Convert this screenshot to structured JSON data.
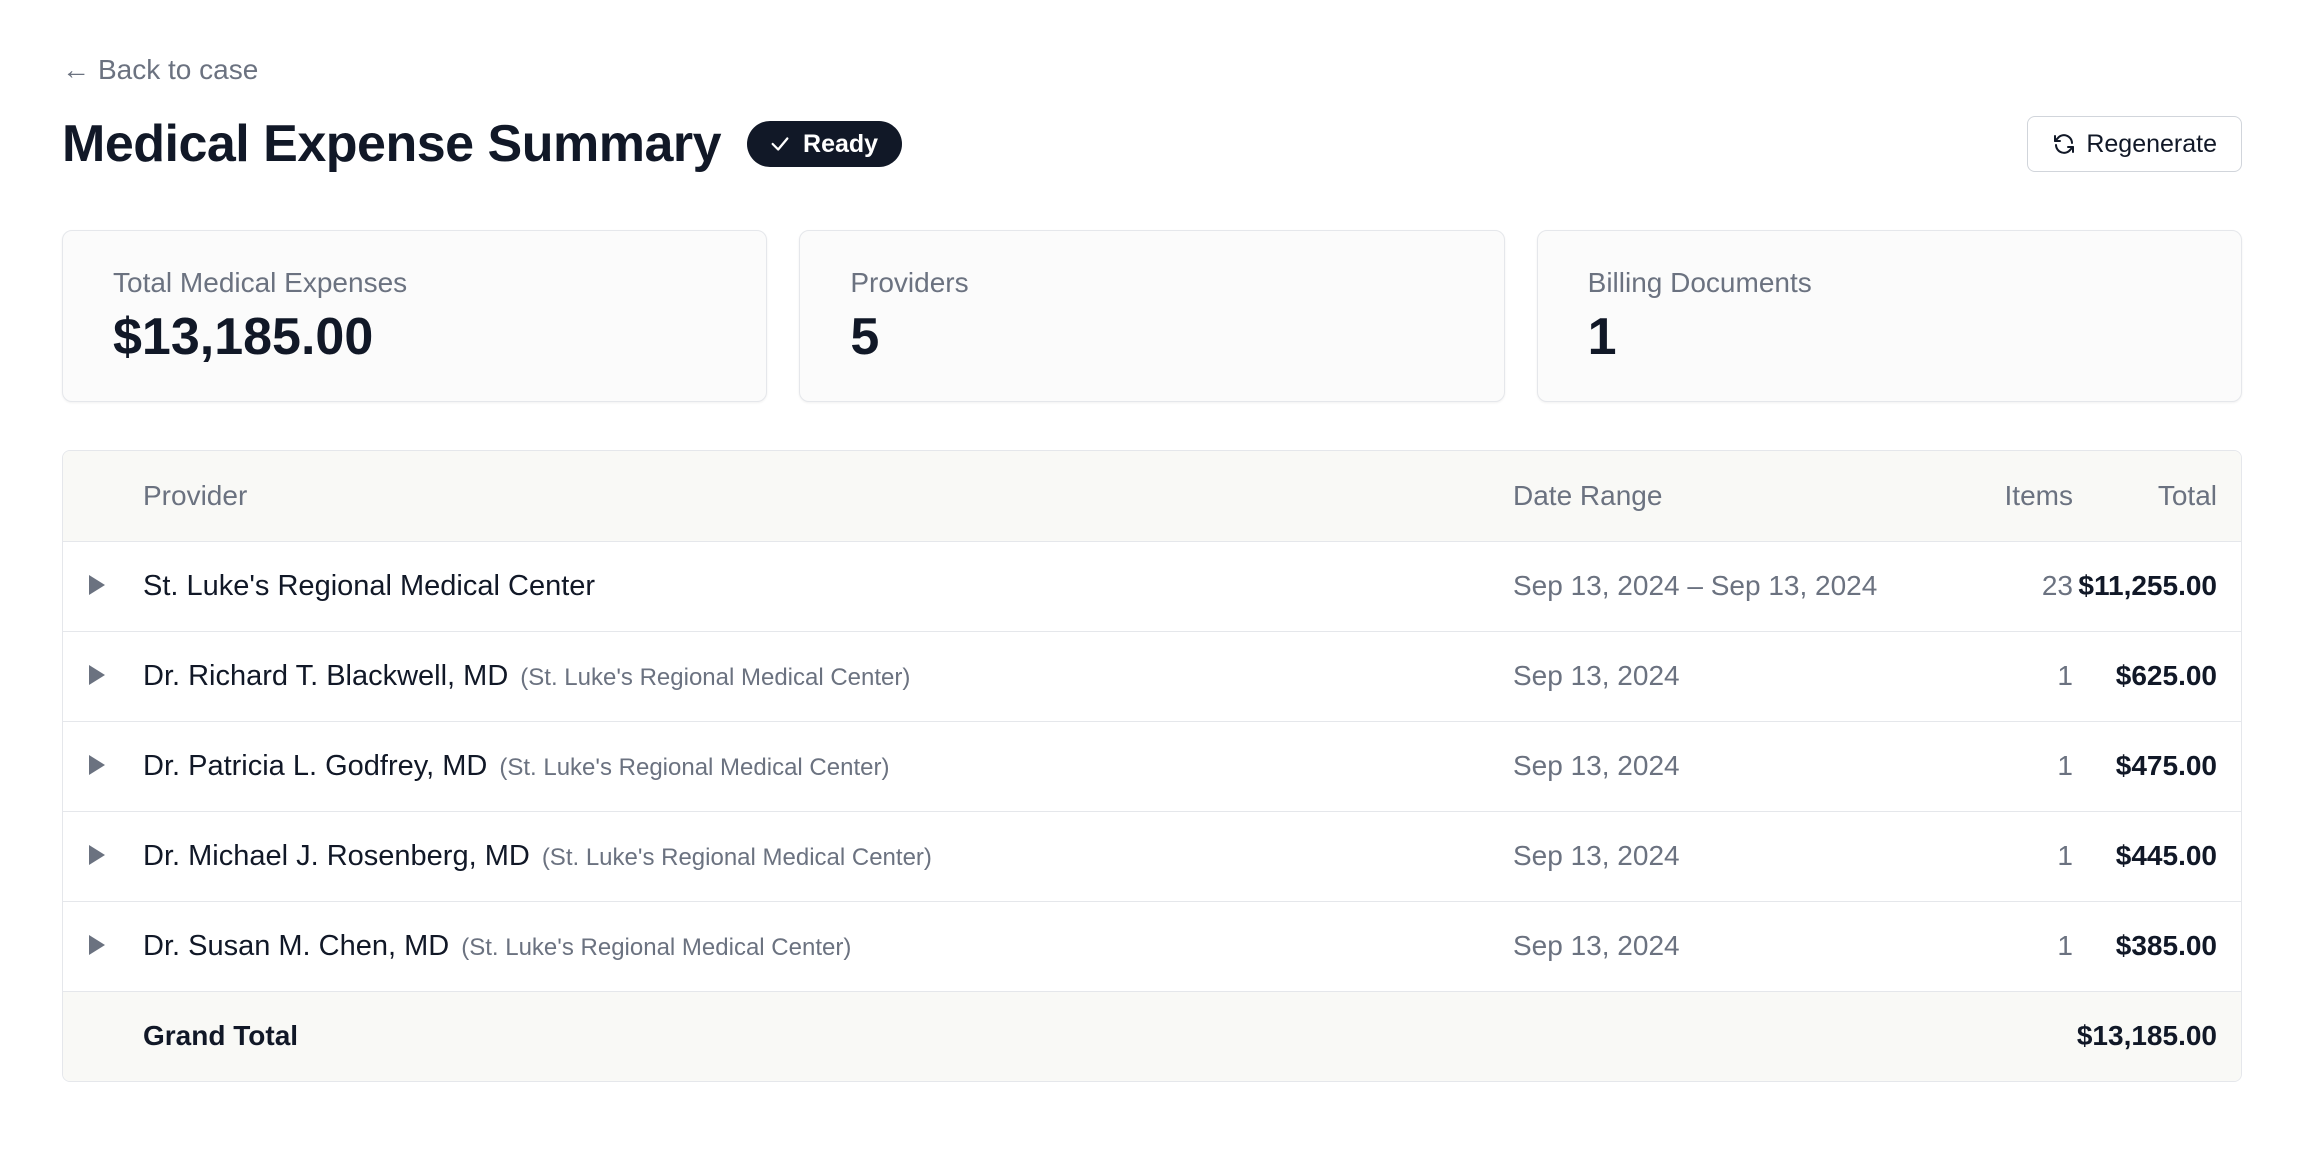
{
  "nav": {
    "back_arrow": "←",
    "back_label": "Back to case"
  },
  "header": {
    "title": "Medical Expense Summary",
    "status_badge": "Ready",
    "status_icon": "check-icon",
    "regenerate_label": "Regenerate",
    "regenerate_icon": "refresh-icon"
  },
  "stats": [
    {
      "label": "Total Medical Expenses",
      "value": "$13,185.00"
    },
    {
      "label": "Providers",
      "value": "5"
    },
    {
      "label": "Billing Documents",
      "value": "1"
    }
  ],
  "table": {
    "headers": {
      "provider": "Provider",
      "date_range": "Date Range",
      "items": "Items",
      "total": "Total"
    },
    "rows": [
      {
        "name": "St. Luke's Regional Medical Center",
        "org": "",
        "date": "Sep 13, 2024 – Sep 13, 2024",
        "items": "23",
        "total": "$11,255.00"
      },
      {
        "name": "Dr. Richard T. Blackwell, MD",
        "org": "(St. Luke's Regional Medical Center)",
        "date": "Sep 13, 2024",
        "items": "1",
        "total": "$625.00"
      },
      {
        "name": "Dr. Patricia L. Godfrey, MD",
        "org": "(St. Luke's Regional Medical Center)",
        "date": "Sep 13, 2024",
        "items": "1",
        "total": "$475.00"
      },
      {
        "name": "Dr. Michael J. Rosenberg, MD",
        "org": "(St. Luke's Regional Medical Center)",
        "date": "Sep 13, 2024",
        "items": "1",
        "total": "$445.00"
      },
      {
        "name": "Dr. Susan M. Chen, MD",
        "org": "(St. Luke's Regional Medical Center)",
        "date": "Sep 13, 2024",
        "items": "1",
        "total": "$385.00"
      }
    ],
    "footer": {
      "label": "Grand Total",
      "total": "$13,185.00"
    }
  },
  "colors": {
    "badge_bg": "#111827",
    "muted_text": "#6b7280",
    "border": "#e5e7eb"
  }
}
